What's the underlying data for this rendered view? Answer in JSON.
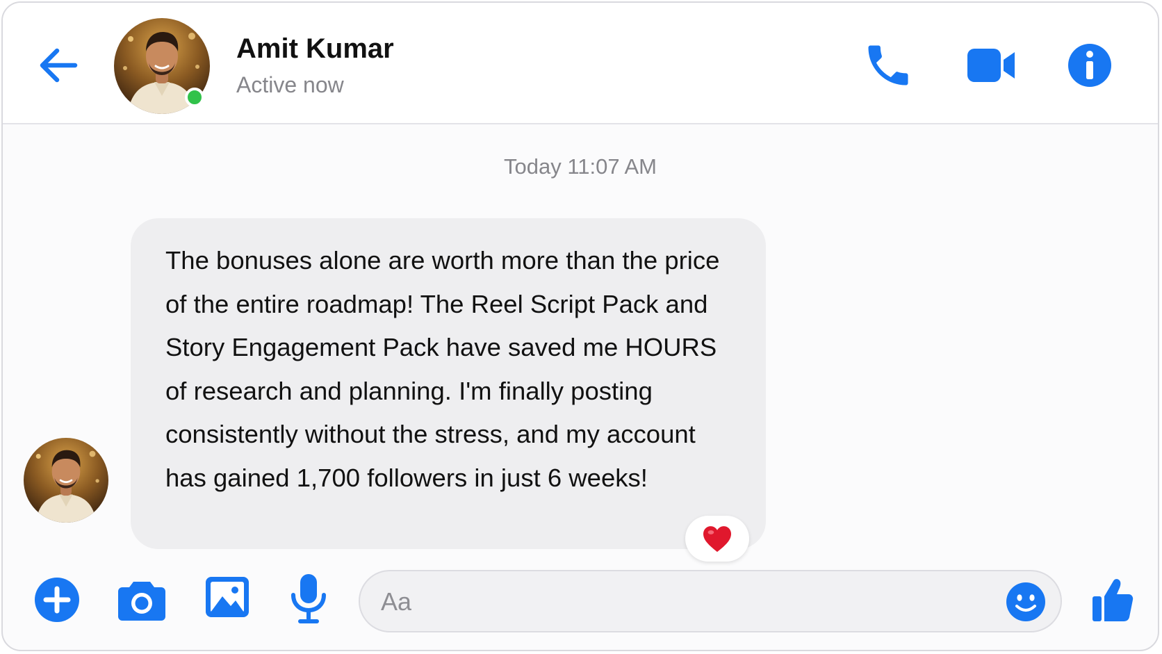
{
  "header": {
    "contact_name": "Amit Kumar",
    "status": "Active now",
    "online": true
  },
  "conversation": {
    "timestamp": "Today 11:07 AM",
    "messages": [
      {
        "sender": "Amit Kumar",
        "text": "The bonuses alone are worth more than the price of the entire roadmap! The Reel Script Pack and Story Engagement Pack have saved me HOURS of research and planning. I'm finally posting consistently without the stress, and my account has gained 1,700 followers in just 6 weeks!",
        "reaction": "heart"
      }
    ]
  },
  "composer": {
    "placeholder": "Aa",
    "value": ""
  },
  "icons": {
    "back": "back-arrow-icon",
    "call": "phone-icon",
    "video": "video-camera-icon",
    "info": "info-icon",
    "plus": "plus-icon",
    "camera": "camera-icon",
    "gallery": "image-icon",
    "mic": "microphone-icon",
    "emoji": "smiley-icon",
    "like": "thumbs-up-icon",
    "reaction": "heart-icon"
  },
  "colors": {
    "accent": "#1877f2",
    "online": "#31c24a",
    "reaction_heart": "#e0182d",
    "bubble_bg": "#eeeef0"
  }
}
